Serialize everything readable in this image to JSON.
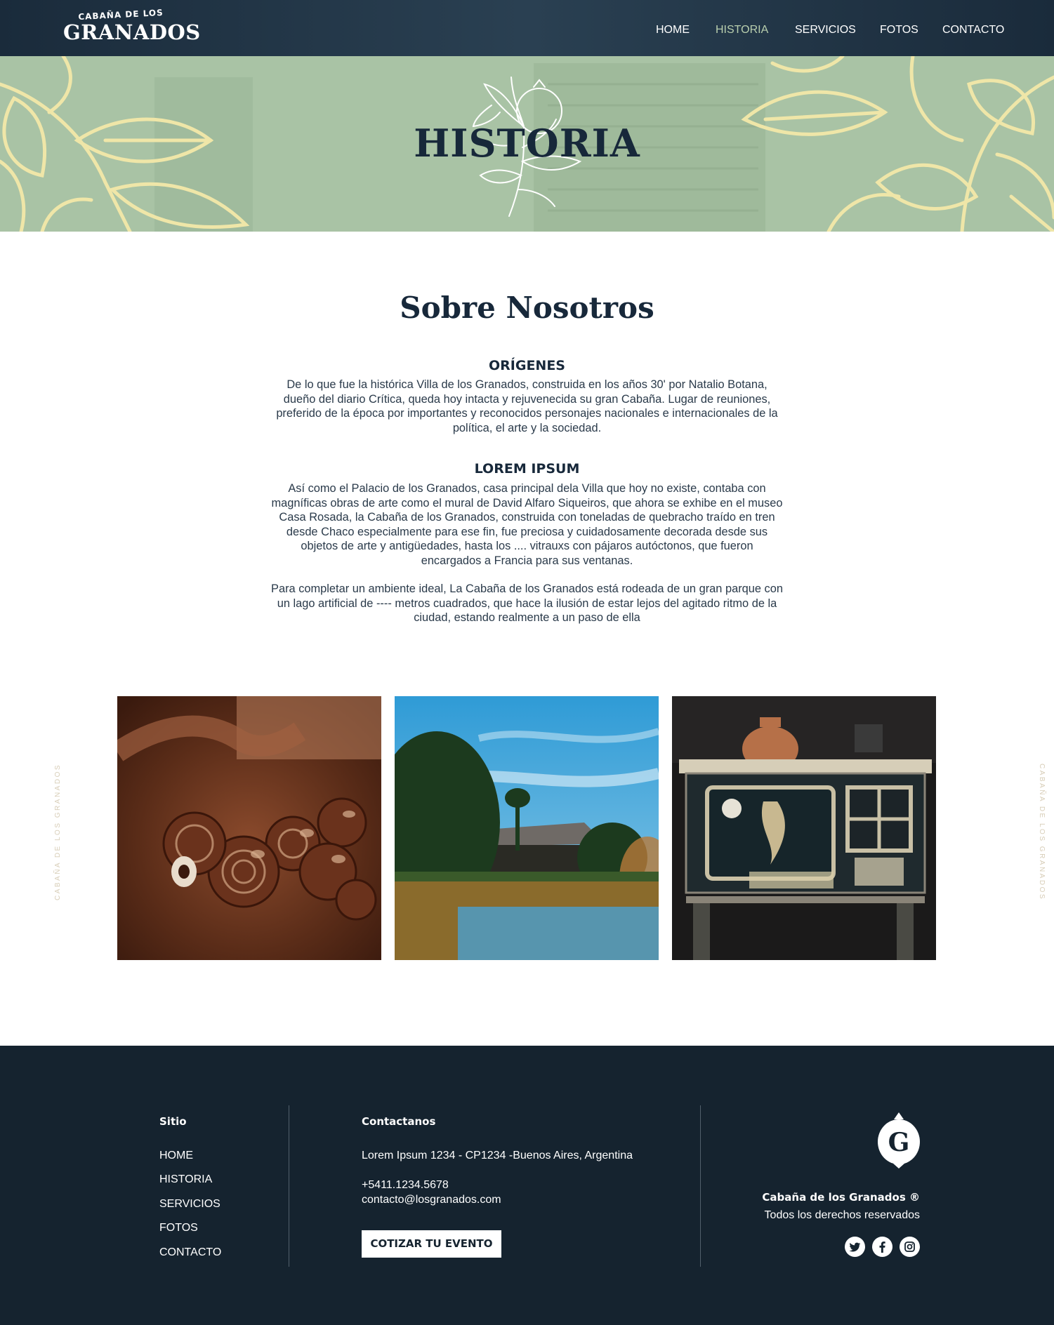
{
  "nav": {
    "logo_top": "CABAÑA DE LOS",
    "logo_main": "GRANADOS",
    "items": [
      "HOME",
      "HISTORIA",
      "SERVICIOS",
      "FOTOS",
      "CONTACTO"
    ],
    "active": "HISTORIA"
  },
  "hero": {
    "title": "HISTORIA"
  },
  "main": {
    "heading": "Sobre Nosotros",
    "sections": [
      {
        "title": "ORÍGENES",
        "lines": [
          "De lo que fue la histórica Villa de los Granados, construida en los años 30' por Natalio Botana,",
          "dueño del diario Crítica, queda hoy intacta y rejuvenecida su gran Cabaña. Lugar de reuniones,",
          "preferido de la época por importantes y reconocidos personajes nacionales e internacionales de la",
          "política, el arte y la sociedad."
        ]
      },
      {
        "title": "LOREM IPSUM",
        "lines": [
          "Así como el Palacio de los Granados, casa principal dela Villa que hoy no existe, contaba con",
          "magníficas obras de arte como el mural de David Alfaro Siqueiros, que ahora se exhibe en el museo",
          "Casa Rosada, la Cabaña de los Granados, construida con toneladas de quebracho traído en tren",
          "desde Chaco especialmente para ese fin, fue preciosa y cuidadosamente decorada desde sus",
          "objetos de arte y antigüedades, hasta los .... vitrauxs con pájaros autóctonos, que fueron",
          "encargados a Francia para sus ventanas."
        ],
        "lines2": [
          "Para completar un ambiente ideal, La Cabaña de los Granados está rodeada de un gran parque con",
          "un lago artificial de ---- metros cuadrados, que hace la ilusión de estar lejos del agitado ritmo de la",
          "ciudad, estando realmente a un paso de ella"
        ]
      }
    ]
  },
  "side_text": "CABAÑA DE LOS GRANADOS",
  "footer": {
    "site_title": "Sitio",
    "site_links": [
      "HOME",
      "HISTORIA",
      "SERVICIOS",
      "FOTOS",
      "CONTACTO"
    ],
    "contact_title": "Contactanos",
    "address": "Lorem Ipsum 1234 - CP1234 -Buenos Aires, Argentina",
    "phone": "+5411.1234.5678",
    "email": "contacto@losgranados.com",
    "cta": "COTIZAR TU EVENTO",
    "brand_name": "Cabaña de los Granados ®",
    "brand_rights": "Todos los derechos reservados",
    "logo_letter": "G"
  },
  "colors": {
    "navy": "#15232f",
    "sage": "#a9c3a5",
    "cream": "#efe6a8",
    "nav_active": "#b9cfae"
  }
}
